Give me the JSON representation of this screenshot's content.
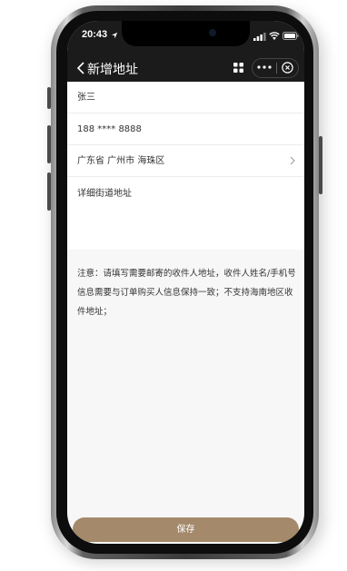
{
  "status_bar": {
    "time": "20:43"
  },
  "nav": {
    "title": "新增地址"
  },
  "form": {
    "name": "张三",
    "phone": "188 **** 8888",
    "region": "广东省 广州市 海珠区",
    "street_placeholder": "详细街道地址"
  },
  "notice": "注意：请填写需要邮寄的收件人地址，收件人姓名/手机号信息需要与订单购买人信息保持一致；不支持海南地区收件地址；",
  "footer": {
    "save_label": "保存"
  },
  "colors": {
    "accent": "#a4896a",
    "nav_bg": "#1b1b1b",
    "screen_bg": "#f7f7f7"
  }
}
